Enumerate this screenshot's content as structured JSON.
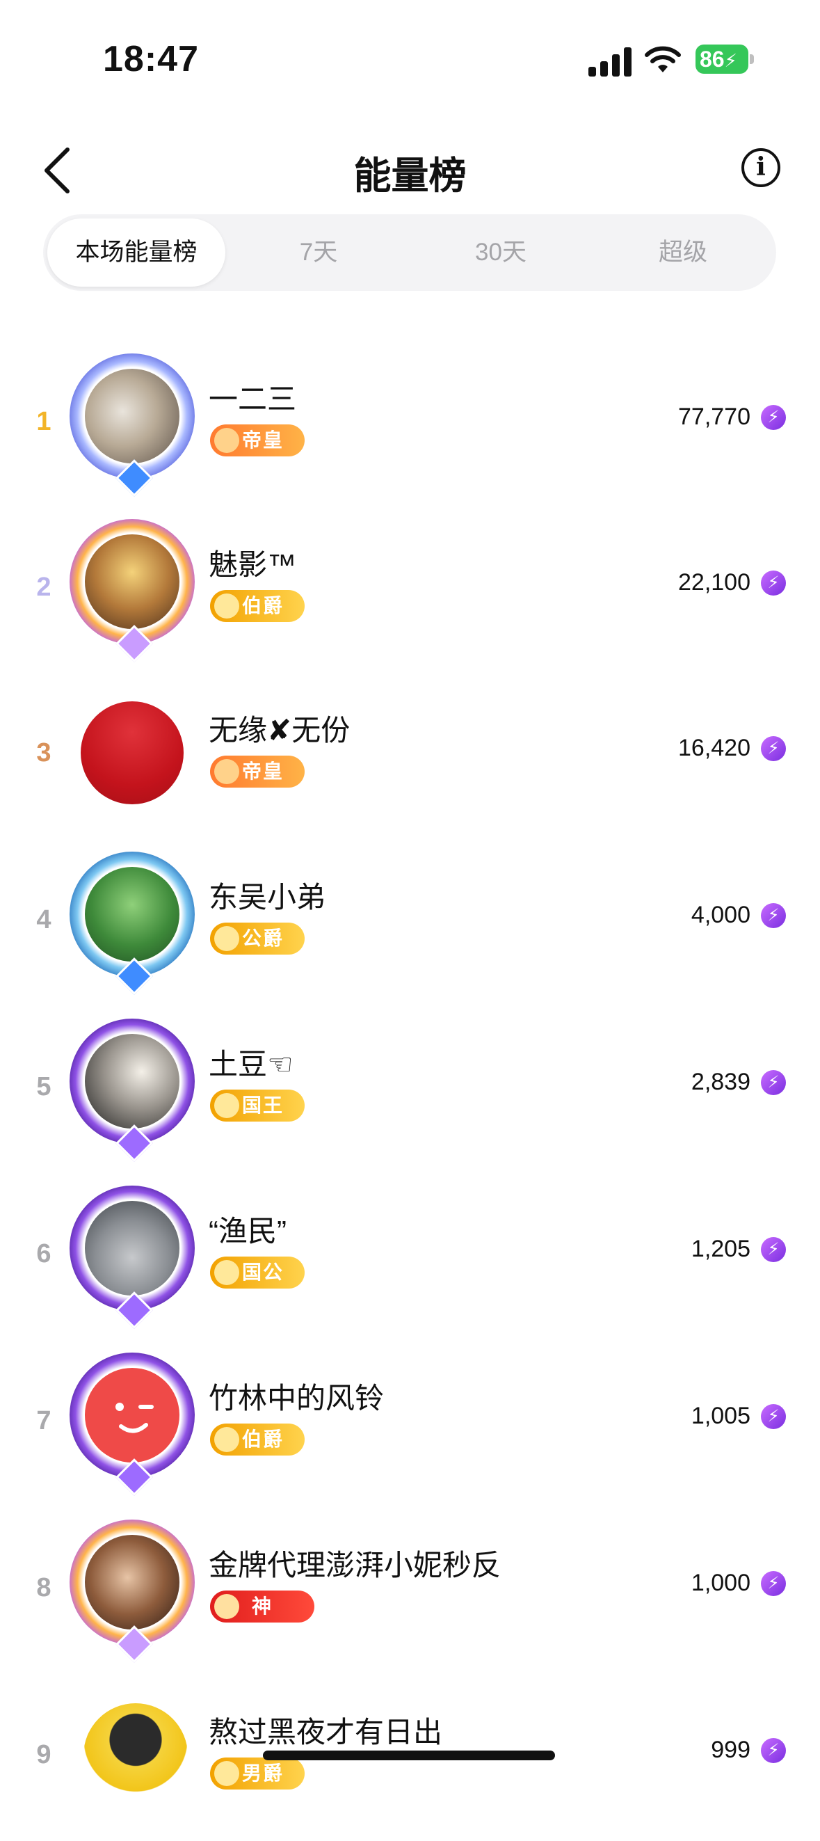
{
  "status": {
    "time": "18:47",
    "battery": "86"
  },
  "nav": {
    "title": "能量榜",
    "info_glyph": "i"
  },
  "tabs": [
    {
      "label": "本场能量榜",
      "active": true
    },
    {
      "label": "7天",
      "active": false
    },
    {
      "label": "30天",
      "active": false
    },
    {
      "label": "超级",
      "active": false
    }
  ],
  "rankings": [
    {
      "rank": "1",
      "name": "一二三",
      "badge": "帝皇",
      "score": "77,770"
    },
    {
      "rank": "2",
      "name": "魅影™",
      "badge": "伯爵",
      "score": "22,100"
    },
    {
      "rank": "3",
      "name": "无缘✘无份",
      "badge": "帝皇",
      "score": "16,420"
    },
    {
      "rank": "4",
      "name": "东吴小弟",
      "badge": "公爵",
      "score": "4,000"
    },
    {
      "rank": "5",
      "name": "土豆☜",
      "badge": "国王",
      "score": "2,839"
    },
    {
      "rank": "6",
      "name": "“渔民”",
      "badge": "国公",
      "score": "1,205"
    },
    {
      "rank": "7",
      "name": "竹林中的风铃",
      "badge": "伯爵",
      "score": "1,005"
    },
    {
      "rank": "8",
      "name": "金牌代理澎湃小妮秒反",
      "badge": "神",
      "score": "1,000"
    },
    {
      "rank": "9",
      "name": "熬过黑夜才有日出",
      "badge": "男爵",
      "score": "999"
    }
  ],
  "colors": {
    "rank1": "#f2b428",
    "rank2": "#b9b4ec",
    "rank3": "#d9925a",
    "rank_other": "#a9a9ac",
    "energy_purple": "#8a3df0"
  },
  "icons": {
    "energy": "lightning-bolt-icon",
    "back": "chevron-left-icon",
    "info": "info-circle-icon"
  }
}
